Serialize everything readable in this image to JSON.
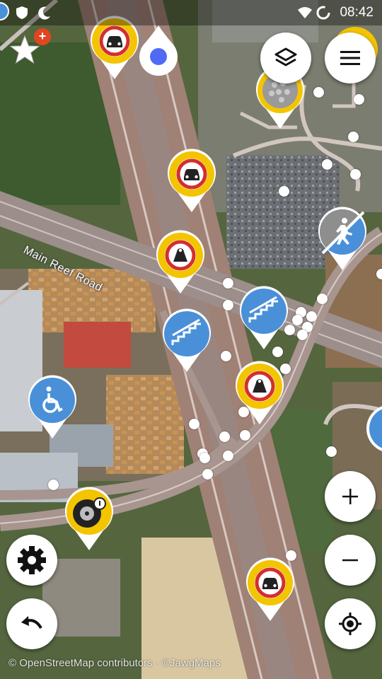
{
  "status_bar": {
    "time": "08:42",
    "icons": [
      "notification-icon",
      "shield-icon",
      "moon-icon",
      "wifi-icon",
      "battery-icon"
    ]
  },
  "map": {
    "road_label": "Main Reef Road",
    "attribution": "© OpenStreetMap contributors · ©JawgMaps"
  },
  "controls": {
    "star_badge": "+",
    "layers": "layers-icon",
    "menu": "menu-icon",
    "zoom_in": "plus-icon",
    "zoom_out": "minus-icon",
    "locate": "gps-locate-icon",
    "settings": "gear-icon",
    "undo": "undo-icon"
  },
  "colors": {
    "quest_yellow": "#f3c400",
    "sign_red": "#d32f2f",
    "quest_blue": "#4a90d9",
    "accent_badge": "#e0461f",
    "location_dot": "#4f6bf5"
  }
}
